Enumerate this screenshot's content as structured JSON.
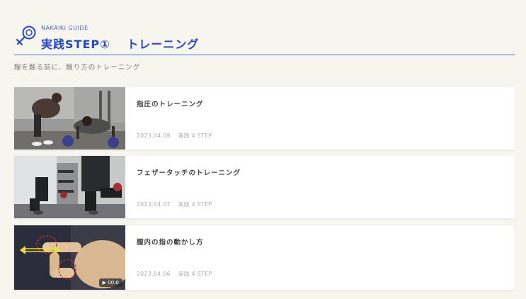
{
  "header": {
    "guide_label": "NAKAIKI GUIDE",
    "title": "実践STEP①　 トレーニング",
    "subtitle": "膣を触る前に、触り方のトレーニング",
    "accent": "#2a46c0"
  },
  "articles": [
    {
      "title": "指圧のトレーニング",
      "date": "2023.04.08",
      "category": "実践 4 STEP",
      "thumbnail_icon": "kettlebell-training-photo"
    },
    {
      "title": "フェザータッチのトレーニング",
      "date": "2023.04.07",
      "category": "実践 4 STEP",
      "thumbnail_icon": "lunge-training-photo"
    },
    {
      "title": "膣内の指の動かし方",
      "date": "2023.04.06",
      "category": "実践 4 STEP",
      "thumbnail_icon": "finger-model-photo",
      "video_duration": "00:0"
    }
  ]
}
